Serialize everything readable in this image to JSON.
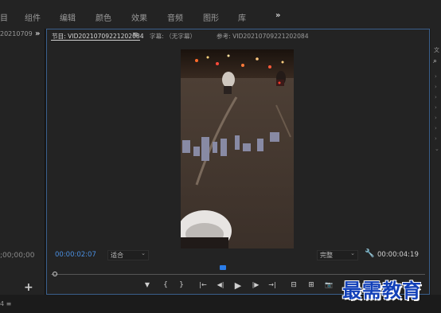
{
  "menu": {
    "items": [
      "组件",
      "编辑",
      "颜色",
      "效果",
      "音频",
      "图形",
      "库"
    ],
    "more": "»"
  },
  "left_panel": {
    "tab_label": "20210709",
    "more": "»",
    "timecode": ";00;00;00",
    "add": "+"
  },
  "monitor": {
    "tabs": {
      "program": "节目: VID20210709221202084",
      "subtitle": "字幕: （无字幕）",
      "reference": "参考: VID20210709221202084"
    },
    "tab_menu": "≡",
    "current_timecode": "00:00:02:07",
    "zoom": "适合",
    "quality": "完整",
    "duration": "00:00:04:19",
    "playhead_fraction": 0.46
  },
  "transport": {
    "marker": "▼",
    "mark_in": "{",
    "mark_out": "}",
    "go_to_in": "|←",
    "step_back": "◀|",
    "play": "▶",
    "step_forward": "|▶",
    "go_to_out": "→|",
    "insert": "⊟",
    "overwrite": "⊞",
    "export_frame": "📷"
  },
  "bottom": {
    "text": "4  ≡"
  },
  "watermark": "最需教育",
  "colors": {
    "accent_blue": "#2b7de9",
    "timecode_blue": "#4a8fe0",
    "panel_border": "#3a5f8c"
  }
}
